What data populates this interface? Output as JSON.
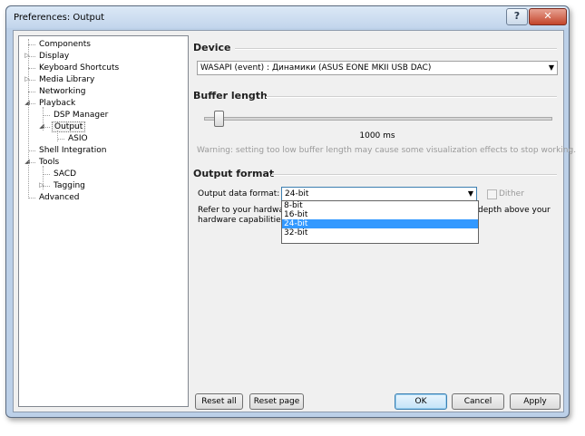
{
  "window": {
    "title": "Preferences: Output"
  },
  "titlebar": {
    "help_glyph": "?",
    "close_glyph": "✕"
  },
  "tree": {
    "items": [
      {
        "label": "Components",
        "level": 0,
        "expander": ""
      },
      {
        "label": "Display",
        "level": 0,
        "expander": "▷"
      },
      {
        "label": "Keyboard Shortcuts",
        "level": 0,
        "expander": ""
      },
      {
        "label": "Media Library",
        "level": 0,
        "expander": "▷"
      },
      {
        "label": "Networking",
        "level": 0,
        "expander": ""
      },
      {
        "label": "Playback",
        "level": 0,
        "expander": "◢"
      },
      {
        "label": "DSP Manager",
        "level": 1,
        "expander": ""
      },
      {
        "label": "Output",
        "level": 1,
        "expander": "◢",
        "selected": true
      },
      {
        "label": "ASIO",
        "level": 2,
        "expander": ""
      },
      {
        "label": "Shell Integration",
        "level": 0,
        "expander": ""
      },
      {
        "label": "Tools",
        "level": 0,
        "expander": "◢"
      },
      {
        "label": "SACD",
        "level": 1,
        "expander": ""
      },
      {
        "label": "Tagging",
        "level": 1,
        "expander": "▷"
      },
      {
        "label": "Advanced",
        "level": 0,
        "expander": ""
      }
    ]
  },
  "device": {
    "section_title": "Device",
    "selected": "WASAPI (event) : Динамики (ASUS EONE MKII USB DAC)"
  },
  "buffer": {
    "section_title": "Buffer length",
    "value_label": "1000 ms",
    "slider_fraction": 0.04,
    "warning": "Warning: setting too low buffer length may cause some visualization effects to stop working."
  },
  "output_format": {
    "section_title": "Output format",
    "data_format_label": "Output data format:",
    "selected": "24-bit",
    "options": [
      "8-bit",
      "16-bit",
      "24-bit",
      "32-bit"
    ],
    "dither_label": "Dither",
    "dither_checked": false,
    "note_line1_a": "Refer to your hardware",
    "note_line1_b": "depth above your",
    "note_line2_a": "hardware capabilities w"
  },
  "buttons": {
    "reset_all": "Reset all",
    "reset_page": "Reset page",
    "ok": "OK",
    "cancel": "Cancel",
    "apply": "Apply"
  },
  "colors": {
    "accent": "#3399ff",
    "window_frame": "#bcd0e8"
  }
}
